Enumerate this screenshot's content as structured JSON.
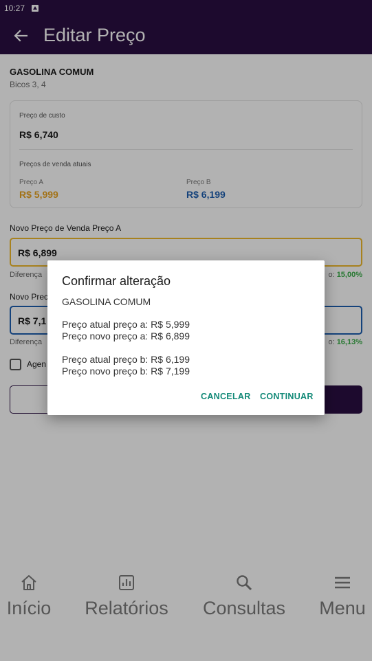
{
  "status_bar": {
    "time": "10:27"
  },
  "app_bar": {
    "title": "Editar Preço"
  },
  "fuel": {
    "name": "GASOLINA COMUM",
    "nozzles": "Bicos 3, 4"
  },
  "price_card": {
    "cost_label": "Preço de custo",
    "cost_value": "R$ 6,740",
    "current_label": "Preços de venda atuais",
    "price_a_label": "Preço A",
    "price_a_value": "R$ 5,999",
    "price_b_label": "Preço B",
    "price_b_value": "R$ 6,199"
  },
  "new_price_a": {
    "label": "Novo Preço de Venda Preço A",
    "value": "R$ 6,899",
    "diff_label": "Diferença",
    "margin_prefix": "o: ",
    "margin_value": "15,00%"
  },
  "new_price_b": {
    "label": "Novo Prec",
    "value": "R$ 7,1",
    "diff_label": "Diferença",
    "margin_prefix": "o: ",
    "margin_value": "16,13%"
  },
  "schedule": {
    "label": "Agen"
  },
  "dialog": {
    "title": "Confirmar alteração",
    "fuel": "GASOLINA COMUM",
    "current_a": "Preço atual preço a: R$ 5,999",
    "new_a": "Preço novo preço a: R$ 6,899",
    "current_b": "Preço atual preço b: R$ 6,199",
    "new_b": "Preço novo preço b: R$ 7,199",
    "cancel": "CANCELAR",
    "continue": "CONTINUAR"
  },
  "bottom_nav": [
    {
      "label": "Início",
      "icon": "home-icon"
    },
    {
      "label": "Relatórios",
      "icon": "bar-chart-icon"
    },
    {
      "label": "Consultas",
      "icon": "search-icon"
    },
    {
      "label": "Menu",
      "icon": "menu-icon"
    }
  ],
  "colors": {
    "primary": "#2a0f42",
    "price_a": "#e8a21f",
    "price_b": "#1e5fb0",
    "margin_positive": "#3cae4a",
    "dialog_action": "#138a78"
  }
}
